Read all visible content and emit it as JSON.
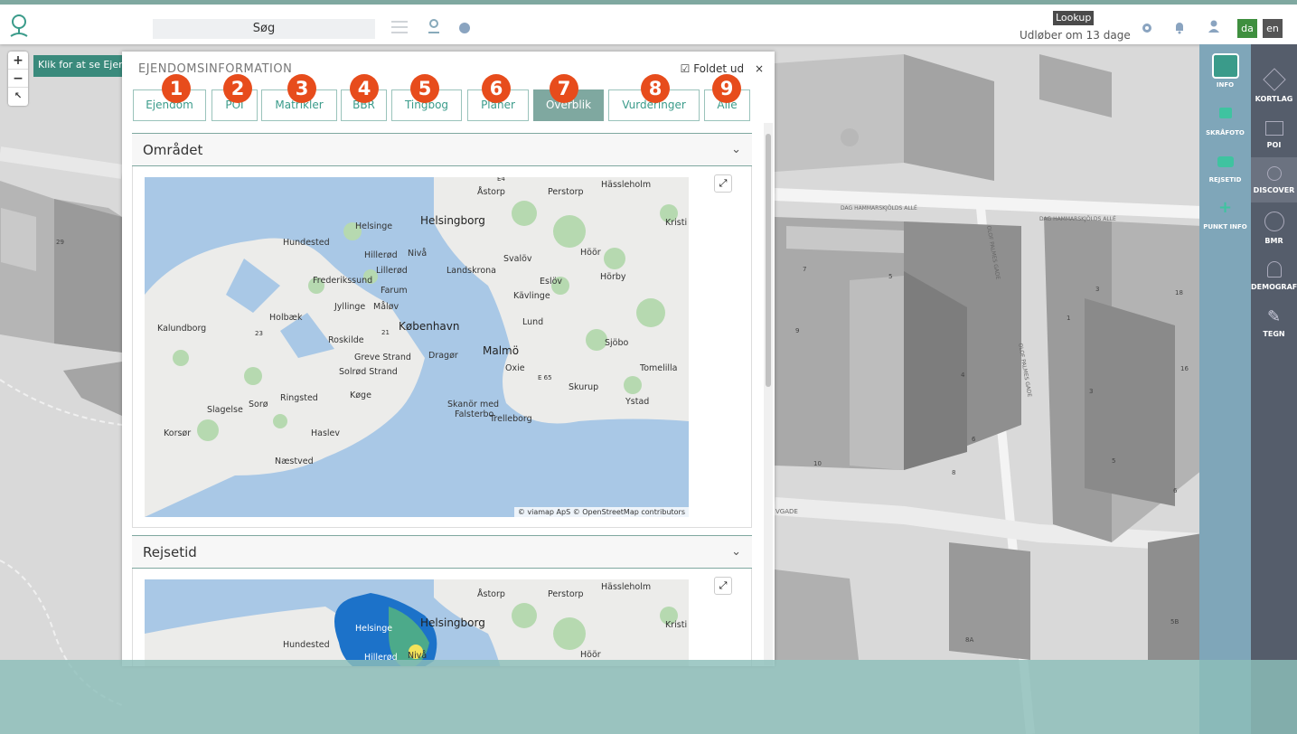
{
  "topbar": {
    "search": "Søg",
    "lookup": "Lookup",
    "expiry": "Udløber om 13 dage",
    "lang_da": "da",
    "lang_en": "en"
  },
  "map_controls": {
    "zoom_in": "+",
    "zoom_out": "−"
  },
  "tooltip": "Klik for at se Ejendomsinformation",
  "panel": {
    "title": "EJENDOMSINFORMATION",
    "folded_label": "Foldet ud",
    "close": "×"
  },
  "tabs": [
    {
      "label": "Ejendom",
      "num": "1"
    },
    {
      "label": "POI",
      "num": "2"
    },
    {
      "label": "Matrikler",
      "num": "3"
    },
    {
      "label": "BBR",
      "num": "4"
    },
    {
      "label": "Tingbog",
      "num": "5"
    },
    {
      "label": "Planer",
      "num": "6"
    },
    {
      "label": "Overblik",
      "num": "7",
      "active": true
    },
    {
      "label": "Vurderinger",
      "num": "8"
    },
    {
      "label": "Alle",
      "num": "9"
    }
  ],
  "sections": [
    {
      "title": "Området"
    },
    {
      "title": "Rejsetid"
    }
  ],
  "map_credit": "© viamap ApS © OpenStreetMap contributors",
  "map_labels": [
    "Hässleholm",
    "Åstorp",
    "Perstorp",
    "E4",
    "Helsingborg",
    "Kristi",
    "Helsinge",
    "Hundested",
    "Hillerød",
    "Nivå",
    "Svalöv",
    "Höör",
    "Lillerød",
    "Landskrona",
    "Frederikssund",
    "Farum",
    "Eslöv",
    "Hörby",
    "Kävlinge",
    "Jyllinge",
    "Måløv",
    "Holbæk",
    "København",
    "Lund",
    "Kalundborg",
    "23",
    "21",
    "Roskilde",
    "Malmö",
    "Sjöbo",
    "Greve Strand",
    "Dragør",
    "Oxie",
    "Tomelilla",
    "Solrød Strand",
    "E 65",
    "Skurup",
    "Sorø",
    "Ringsted",
    "Køge",
    "Skanör med",
    "Falsterbo",
    "Trelleborg",
    "Ystad",
    "Slagelse",
    "Korsør",
    "Haslev",
    "Næstved"
  ],
  "right_sidebar": [
    {
      "label": "INFO"
    },
    {
      "label": "SKRÅFOTO"
    },
    {
      "label": "REJSETID"
    },
    {
      "label": "PUNKT INFO"
    }
  ],
  "far_sidebar": [
    {
      "label": "KORTLAG"
    },
    {
      "label": "POI"
    },
    {
      "label": "DISCOVER"
    },
    {
      "label": "BMR"
    },
    {
      "label": "DEMOGRAFI"
    },
    {
      "label": "TEGN"
    }
  ],
  "street_labels": [
    "DAG HAMMARSKJÖLDS ALLÉ",
    "DAG HAMMARSKJÖLDS ALLÉ",
    "OLOF PALMES GADE",
    "OLOF PALMES GADE",
    "VGADE"
  ],
  "building_numbers": [
    "29",
    "7",
    "5",
    "3",
    "18",
    "1",
    "9",
    "4",
    "3",
    "16",
    "6",
    "10",
    "5",
    "8",
    "6",
    "5",
    "8A",
    "5B"
  ],
  "colors": {
    "accent": "#7fa8a0",
    "badge": "#e74c1c",
    "lang_active": "#3f8f3f"
  }
}
